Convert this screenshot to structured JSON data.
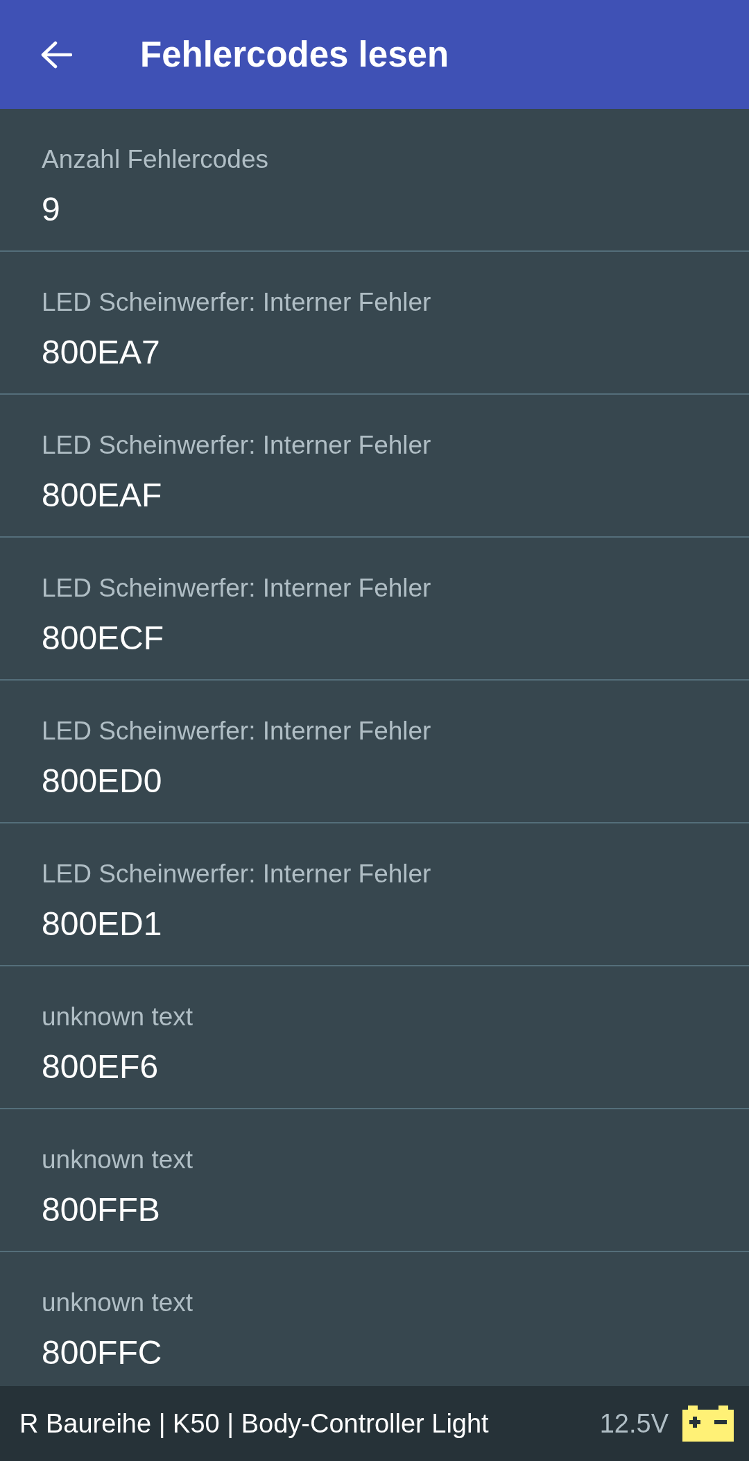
{
  "app_bar": {
    "title": "Fehlercodes lesen"
  },
  "items": [
    {
      "label": "Anzahl Fehlercodes",
      "value": "9"
    },
    {
      "label": "LED Scheinwerfer: Interner Fehler",
      "value": "800EA7"
    },
    {
      "label": "LED Scheinwerfer: Interner Fehler",
      "value": "800EAF"
    },
    {
      "label": "LED Scheinwerfer: Interner Fehler",
      "value": "800ECF"
    },
    {
      "label": "LED Scheinwerfer: Interner Fehler",
      "value": "800ED0"
    },
    {
      "label": "LED Scheinwerfer: Interner Fehler",
      "value": "800ED1"
    },
    {
      "label": "unknown text",
      "value": "800EF6"
    },
    {
      "label": "unknown text",
      "value": "800FFB"
    },
    {
      "label": "unknown text",
      "value": "800FFC"
    }
  ],
  "status_bar": {
    "vehicle": "R Baureihe | K50 | Body-Controller Light",
    "voltage": "12.5V"
  }
}
